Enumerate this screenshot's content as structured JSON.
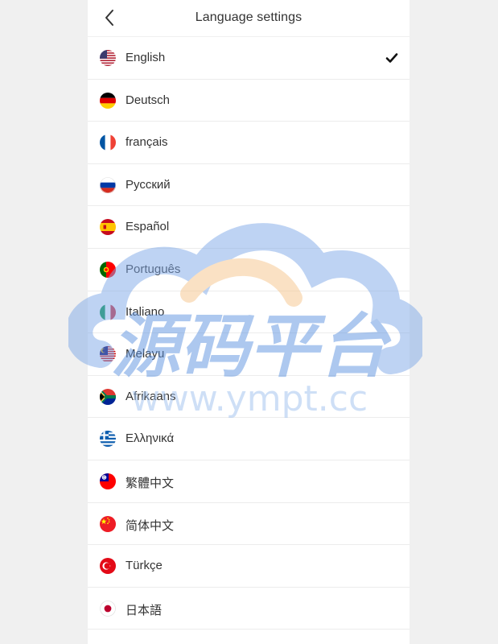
{
  "header": {
    "title": "Language settings",
    "back_icon": "chevron-left-icon"
  },
  "languages": [
    {
      "label": "English",
      "flag": "us-flag-icon",
      "selected": true
    },
    {
      "label": "Deutsch",
      "flag": "de-flag-icon",
      "selected": false
    },
    {
      "label": "français",
      "flag": "fr-flag-icon",
      "selected": false
    },
    {
      "label": "Русский",
      "flag": "ru-flag-icon",
      "selected": false
    },
    {
      "label": "Español",
      "flag": "es-flag-icon",
      "selected": false
    },
    {
      "label": "Português",
      "flag": "pt-flag-icon",
      "selected": false
    },
    {
      "label": "Italiano",
      "flag": "it-flag-icon",
      "selected": false
    },
    {
      "label": "Melayu",
      "flag": "my-flag-icon",
      "selected": false
    },
    {
      "label": "Afrikaans",
      "flag": "za-flag-icon",
      "selected": false
    },
    {
      "label": "Ελληνικά",
      "flag": "gr-flag-icon",
      "selected": false
    },
    {
      "label": "繁體中文",
      "flag": "tw-flag-icon",
      "selected": false
    },
    {
      "label": "简体中文",
      "flag": "cn-flag-icon",
      "selected": false
    },
    {
      "label": "Türkçe",
      "flag": "tr-flag-icon",
      "selected": false
    },
    {
      "label": "日本語",
      "flag": "jp-flag-icon",
      "selected": false
    }
  ],
  "watermark": {
    "text_cn": "源码平台",
    "text_url": "www.ympt.cc"
  },
  "colors": {
    "background": "#f0f0f0",
    "panel": "#ffffff",
    "text": "#333333",
    "divider": "#ececec"
  }
}
